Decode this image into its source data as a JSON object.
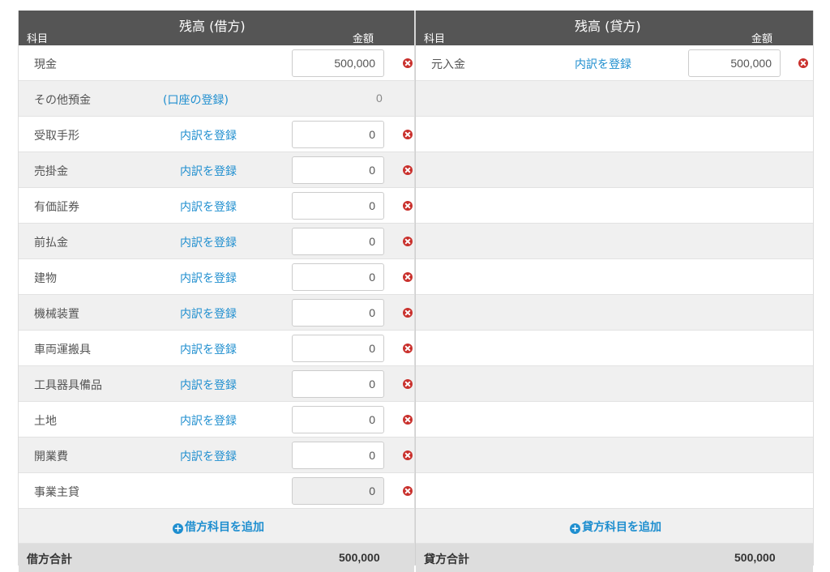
{
  "debit": {
    "header": {
      "kamoku": "科目",
      "title": "残高 (借方)",
      "kingaku": "金額"
    },
    "rows": [
      {
        "name": "現金",
        "link": "",
        "amount": "500,000",
        "kind": "input",
        "delete": true
      },
      {
        "name": "その他預金",
        "link": "(口座の登録)",
        "amount": "0",
        "kind": "plain",
        "delete": false
      },
      {
        "name": "受取手形",
        "link": "内訳を登録",
        "amount": "0",
        "kind": "input",
        "delete": true
      },
      {
        "name": "売掛金",
        "link": "内訳を登録",
        "amount": "0",
        "kind": "input",
        "delete": true
      },
      {
        "name": "有価証券",
        "link": "内訳を登録",
        "amount": "0",
        "kind": "input",
        "delete": true
      },
      {
        "name": "前払金",
        "link": "内訳を登録",
        "amount": "0",
        "kind": "input",
        "delete": true
      },
      {
        "name": "建物",
        "link": "内訳を登録",
        "amount": "0",
        "kind": "input",
        "delete": true
      },
      {
        "name": "機械装置",
        "link": "内訳を登録",
        "amount": "0",
        "kind": "input",
        "delete": true
      },
      {
        "name": "車両運搬具",
        "link": "内訳を登録",
        "amount": "0",
        "kind": "input",
        "delete": true
      },
      {
        "name": "工具器具備品",
        "link": "内訳を登録",
        "amount": "0",
        "kind": "input",
        "delete": true
      },
      {
        "name": "土地",
        "link": "内訳を登録",
        "amount": "0",
        "kind": "input",
        "delete": true
      },
      {
        "name": "開業費",
        "link": "内訳を登録",
        "amount": "0",
        "kind": "input",
        "delete": true
      },
      {
        "name": "事業主貸",
        "link": "",
        "amount": "0",
        "kind": "disabled",
        "delete": true
      }
    ],
    "add_label": "借方科目を追加",
    "total_label": "借方合計",
    "total_value": "500,000"
  },
  "credit": {
    "header": {
      "kamoku": "科目",
      "title": "残高 (貸方)",
      "kingaku": "金額"
    },
    "rows": [
      {
        "name": "元入金",
        "link": "内訳を登録",
        "amount": "500,000",
        "kind": "input",
        "delete": true
      }
    ],
    "add_label": "貸方科目を追加",
    "total_label": "貸方合計",
    "total_value": "500,000"
  },
  "colors": {
    "header_bg": "#555555",
    "link": "#1e8ecf",
    "delete": "#c9302c",
    "stripe": "#f0f0f0",
    "total_bg": "#dddddd"
  },
  "icons": {
    "delete": "times-circle-icon",
    "add": "plus-circle-icon"
  }
}
